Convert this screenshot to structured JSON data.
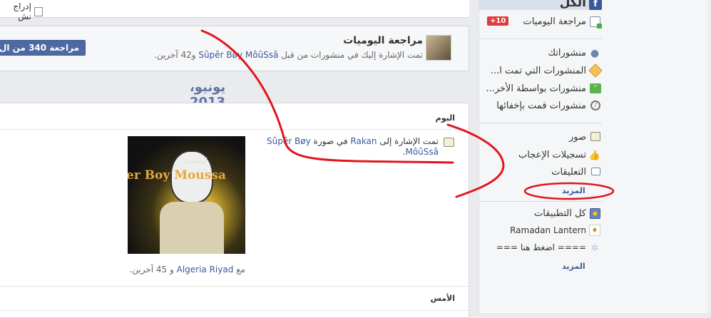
{
  "top": {
    "checkbox_label": "إدراج نش"
  },
  "review": {
    "title": "مراجعة اليوميات",
    "subtitle_prefix": "تمت الإشارة إليك في منشورات من قبل",
    "subtitle_name": "Sûpêr Bøy MôûSsâ",
    "subtitle_suffix": "و42 آخرين.",
    "button_label": "مراجعة 340 من ال"
  },
  "timeline": {
    "month_label": "يونيو، 2013"
  },
  "feed": {
    "today_label": "اليوم",
    "post_text_prefix": "تمت الإشارة إلى",
    "post_person": "Rakan",
    "post_text_mid": "في صورة",
    "post_author": "Sûpêr Bøy MôûSsâ",
    "photo_caption": "er Boy Moussa",
    "photo_arabic": "أنونيموس",
    "with_prefix": "مع",
    "with_person": "Algeria Riyad",
    "with_suffix": "و 45 آخرين.",
    "yesterday_label": "الأمس"
  },
  "sidebar": {
    "all_label": "الكل",
    "review_label": "مراجعة اليوميات",
    "review_badge": "+10",
    "items": [
      {
        "label": "منشوراتك"
      },
      {
        "label": "المنشورات التي تمت ا..."
      },
      {
        "label": "منشورات بواسطة الأخر..."
      },
      {
        "label": "منشورات قمت بإخفائها"
      },
      {
        "label": "صور"
      },
      {
        "label": "تسجيلات الإعجاب"
      },
      {
        "label": "التعليقات"
      }
    ],
    "more_label": "المزيد",
    "apps": [
      {
        "label": "كل التطبيقات"
      },
      {
        "label": "Ramadan Lantern"
      },
      {
        "label": "==== اضغط هنا ==="
      }
    ],
    "more_label_2": "المزيد"
  },
  "colors": {
    "brand": "#3b5998",
    "badge": "#e0393e",
    "annotation": "#e0151c"
  }
}
